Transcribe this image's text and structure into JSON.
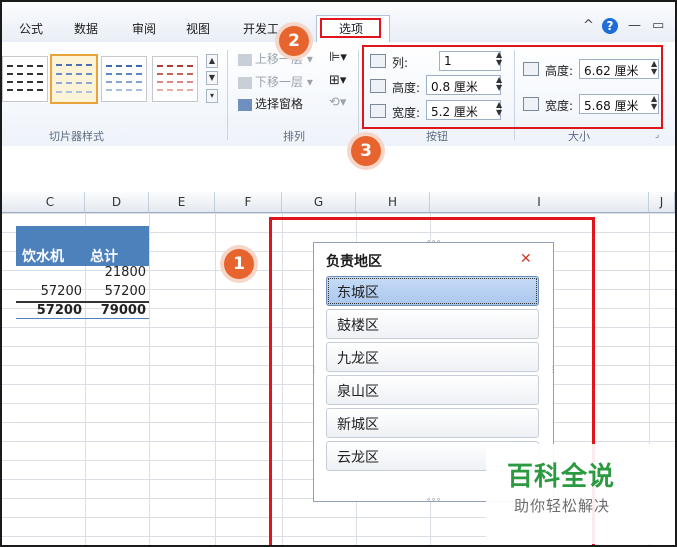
{
  "tabs": [
    "公式",
    "数据",
    "审阅",
    "视图",
    "开发工"
  ],
  "active_tab": "选项",
  "window_controls": [
    "^",
    "?",
    "—",
    "▭"
  ],
  "ribbon": {
    "styles_group_label": "切片器样式",
    "arrange": {
      "bring_forward": "上移一层",
      "send_backward": "下移一层",
      "selection_pane": "选择窗格",
      "group_label": "排列"
    },
    "buttons": {
      "columns_label": "列:",
      "columns_value": "1",
      "height_label": "高度:",
      "height_value": "0.8 厘米",
      "width_label": "宽度:",
      "width_value": "5.2 厘米",
      "group_label": "按钮"
    },
    "size": {
      "height_label": "高度:",
      "height_value": "6.62 厘米",
      "width_label": "宽度:",
      "width_value": "5.68 厘米",
      "group_label": "大小"
    }
  },
  "badges": [
    "1",
    "2",
    "3"
  ],
  "columns": [
    "C",
    "D",
    "E",
    "F",
    "G",
    "H",
    "I",
    "J"
  ],
  "table": {
    "headers": [
      "饮水机",
      "总计"
    ],
    "rows": [
      [
        "",
        "21800"
      ],
      [
        "57200",
        "57200"
      ],
      [
        "57200",
        "79000"
      ]
    ]
  },
  "slicer": {
    "title": "负责地区",
    "items": [
      "东城区",
      "鼓楼区",
      "九龙区",
      "泉山区",
      "新城区",
      "云龙区"
    ],
    "selected": "东城区"
  },
  "watermark": {
    "main": "百科全说",
    "sub": "助你轻松解决"
  }
}
